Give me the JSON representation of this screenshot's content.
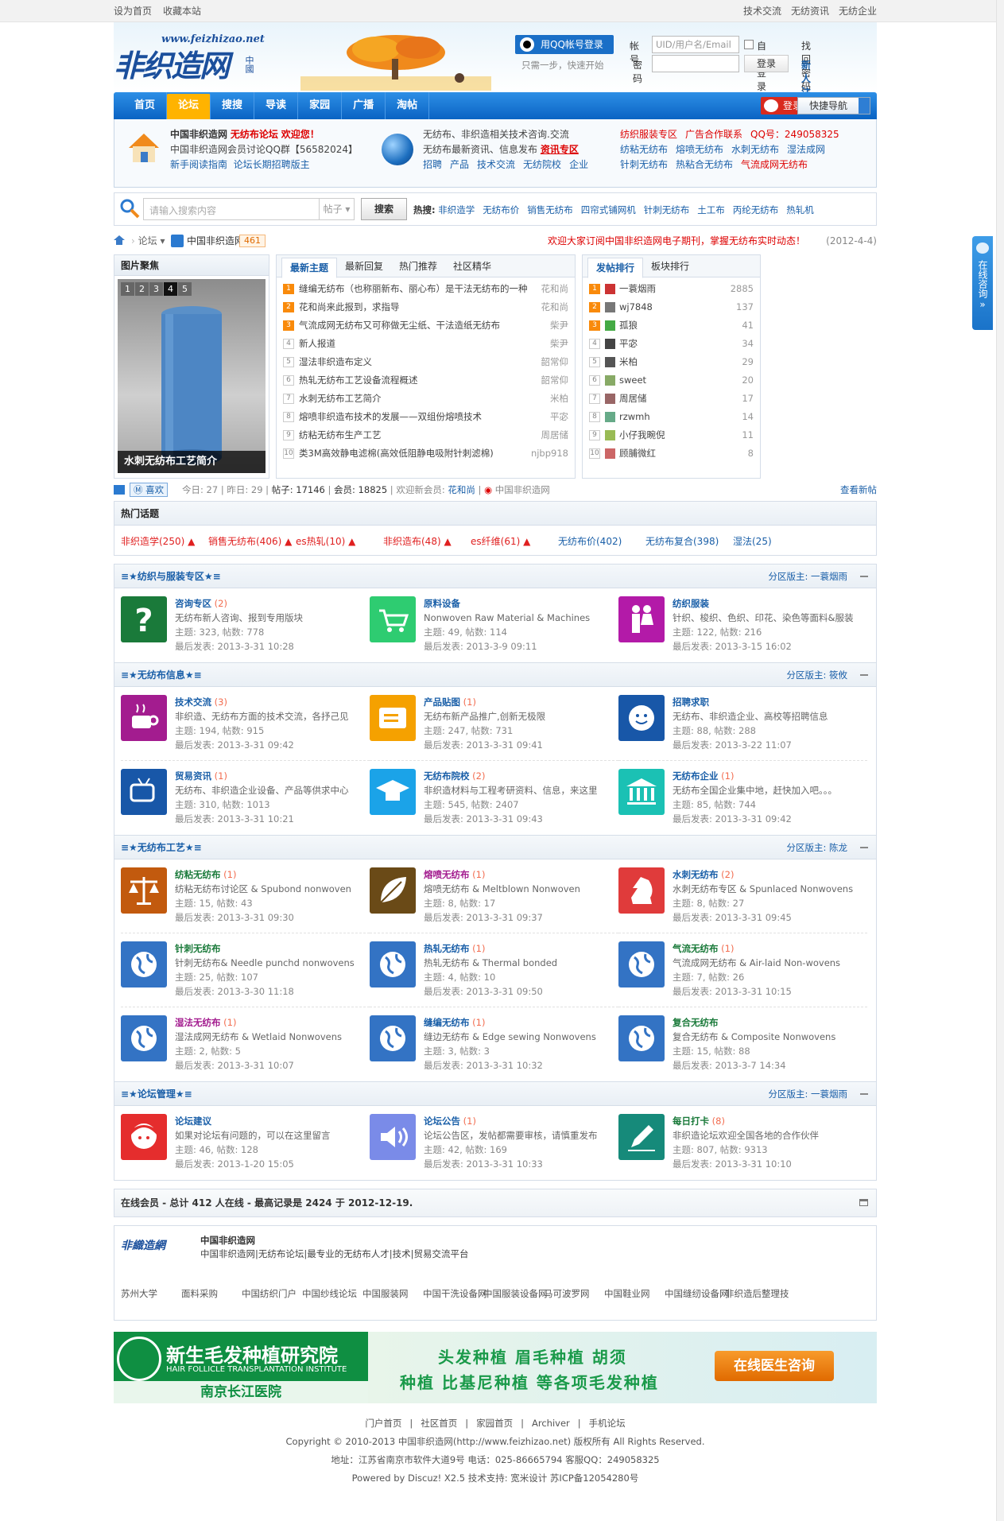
{
  "topbar": {
    "left": [
      "设为首页",
      "收藏本站"
    ],
    "right": [
      "技术交流",
      "无纺资讯",
      "无纺企业"
    ]
  },
  "header": {
    "logo_url_text": "www.feizhizao.net",
    "logo_brush": "非织造网",
    "logo_cn": "中國",
    "qq_login": "用QQ帐号登录",
    "qq_tip": "只需一步，快速开始",
    "account_label": "帐号",
    "account_placeholder": "UID/用户名/Email",
    "auto_login": "自动登录",
    "find_pw": "找回密码",
    "password_label": "密码",
    "login_btn": "登录",
    "register": "新人注册"
  },
  "nav": {
    "items": [
      "首页",
      "论坛",
      "搜搜",
      "导读",
      "家园",
      "广播",
      "淘帖"
    ],
    "active": 1,
    "weibo_login": "登录",
    "quick_nav": "快捷导航"
  },
  "info": {
    "c1": {
      "l1a": "中国非织造网",
      "l1b": "无纺布论坛",
      "l1c": "欢迎您！",
      "l2": "中国非织造网会员讨论QQ群【56582024】",
      "l3a": "新手阅读指南",
      "l3b": "论坛长期招聘版主"
    },
    "c2": {
      "l1": "无纺布、非织造相关技术咨询.交流",
      "l2a": "无纺布最新资讯、信息发布",
      "l2b": "资讯专区",
      "l3": [
        "招聘",
        "产品",
        "技术交流",
        "无纺院校",
        "企业"
      ]
    },
    "c3": {
      "l1": [
        "纺织服装专区",
        "广告合作联系",
        "QQ号：249058325"
      ],
      "l2": [
        "纺粘无纺布",
        "熔喷无纺布",
        "水刺无纺布",
        "湿法成网"
      ],
      "l3": [
        "针刺无纺布",
        "热粘合无纺布",
        "气流成网无纺布"
      ]
    }
  },
  "search": {
    "placeholder": "请输入搜索内容",
    "type": "帖子",
    "button": "搜索",
    "hot_label": "热搜:",
    "hot": [
      "非织造学",
      "无纺布价",
      "销售无纺布",
      "四帘式铺网机",
      "针刺无纺布",
      "土工布",
      "丙纶无纺布",
      "热轧机"
    ]
  },
  "crumb": {
    "forum": "论坛",
    "site": "中国非织造网",
    "count": "461",
    "notice": "欢迎大家订阅中国非织造网电子期刊，掌握无纺布实时动态！",
    "date": "(2012-4-4)"
  },
  "focus": {
    "title": "图片聚焦",
    "pages": [
      "1",
      "2",
      "3",
      "4",
      "5"
    ],
    "active": 3,
    "caption": "水刺无纺布工艺简介"
  },
  "threads": {
    "tabs": [
      "最新主题",
      "最新回复",
      "热门推荐",
      "社区精华"
    ],
    "items": [
      {
        "n": "1",
        "t": "缝编无纺布（也称丽新布、丽心布）是干法无纺布的一种",
        "a": "花和尚"
      },
      {
        "n": "2",
        "t": "花和尚来此报到，求指导",
        "a": "花和尚"
      },
      {
        "n": "3",
        "t": "气流成网无纺布又可称做无尘纸、干法造纸无纺布",
        "a": "柴尹"
      },
      {
        "n": "4",
        "t": "新人报道",
        "a": "柴尹"
      },
      {
        "n": "5",
        "t": "湿法非织造布定义",
        "a": "韶常仰"
      },
      {
        "n": "6",
        "t": "热轧无纺布工艺设备流程概述",
        "a": "韶常仰"
      },
      {
        "n": "7",
        "t": "水刺无纺布工艺简介",
        "a": "米柏"
      },
      {
        "n": "8",
        "t": "熔喷非织造布技术的发展——双组份熔喷技术",
        "a": "平宓"
      },
      {
        "n": "9",
        "t": "纺粘无纺布生产工艺",
        "a": "周居储"
      },
      {
        "n": "10",
        "t": "类3M高效静电滤棉(高效低阻静电吸附针刺滤棉)",
        "a": "njbp918"
      }
    ]
  },
  "ranks": {
    "tabs": [
      "发帖排行",
      "板块排行"
    ],
    "items": [
      {
        "n": "1",
        "u": "一蓑烟雨",
        "c": "2885",
        "col": "#c33"
      },
      {
        "n": "2",
        "u": "wj7848",
        "c": "137",
        "col": "#777"
      },
      {
        "n": "3",
        "u": "孤狼",
        "c": "41",
        "col": "#4a4"
      },
      {
        "n": "4",
        "u": "平宓",
        "c": "34",
        "col": "#444"
      },
      {
        "n": "5",
        "u": "米柏",
        "c": "29",
        "col": "#555"
      },
      {
        "n": "6",
        "u": "sweet",
        "c": "20",
        "col": "#8a6"
      },
      {
        "n": "7",
        "u": "周居储",
        "c": "17",
        "col": "#966"
      },
      {
        "n": "8",
        "u": "rzwmh",
        "c": "14",
        "col": "#6a8"
      },
      {
        "n": "9",
        "u": "小仔我畹倪",
        "c": "11",
        "col": "#9b5"
      },
      {
        "n": "10",
        "u": "顾脯微红",
        "c": "8",
        "col": "#c66"
      }
    ]
  },
  "stats": {
    "like": "喜欢",
    "today": "今日: 27",
    "yesterday": "昨日: 29",
    "posts": "帖子: 17146",
    "members": "会员: 18825",
    "welcome": "欢迎新会员:",
    "newmember": "花和尚",
    "weibo": "中国非织造网",
    "view_new": "查看新帖"
  },
  "hot_topics": {
    "title": "热门话题",
    "items": [
      {
        "t": "非织造学(250)",
        "hot": true
      },
      {
        "t": "销售无纺布(406)",
        "hot": true
      },
      {
        "t": "es热轧(10)",
        "hot": true
      },
      {
        "t": "非织造布(48)",
        "hot": true
      },
      {
        "t": "es纤维(61)",
        "hot": true
      },
      {
        "t": "无纺布价(402)",
        "hot": false
      },
      {
        "t": "无纺布复合(398)",
        "hot": false
      },
      {
        "t": "湿法(25)",
        "hot": false
      }
    ]
  },
  "sections": [
    {
      "title": "≡★纺织与服装专区★≡",
      "mod_label": "分区版主:",
      "mod": "一蓑烟雨",
      "forums": [
        {
          "name": "咨询专区",
          "count": "(2)",
          "desc": "无纺布新人咨询、报到专用版块",
          "stat": "主题: 323, 帖数: 778",
          "last": "最后发表: 2013-3-31 10:28",
          "icon": "question",
          "color": "#1a7a3a"
        },
        {
          "name": "原料设备",
          "count": "",
          "desc": "Nonwoven Raw Material & Machines",
          "stat": "主题: 49, 帖数: 114",
          "last": "最后发表: 2013-3-9 09:11",
          "icon": "cart",
          "color": "#2ecc71"
        },
        {
          "name": "纺织服装",
          "count": "",
          "desc": "针织、梭织、色织、印花、染色等面料&服装",
          "stat": "主题: 122, 帖数: 216",
          "last": "最后发表: 2013-3-15 16:02",
          "icon": "people",
          "color": "#b31aa8"
        }
      ]
    },
    {
      "title": "≡★无纺布信息★≡",
      "mod_label": "分区版主:",
      "mod": "筱攸",
      "forums": [
        {
          "name": "技术交流",
          "count": "(3)",
          "desc": "非织造、无纺布方面的技术交流，各抒己见",
          "stat": "主题: 194, 帖数: 915",
          "last": "最后发表: 2013-3-31 09:42",
          "icon": "cup",
          "color": "#a31c8f"
        },
        {
          "name": "产品贴图",
          "count": "(1)",
          "desc": "无纺布新产品推广,创新无极限",
          "stat": "主题: 247, 帖数: 731",
          "last": "最后发表: 2013-3-31 09:41",
          "icon": "folder",
          "color": "#f5a100"
        },
        {
          "name": "招聘求职",
          "count": "",
          "desc": "无纺布、非织造企业、高校等招聘信息",
          "stat": "主题: 88, 帖数: 288",
          "last": "最后发表: 2013-3-22 11:07",
          "icon": "smile",
          "color": "#1857a8"
        },
        {
          "name": "贸易资讯",
          "count": "(1)",
          "desc": "无纺布、非织造企业设备、产品等供求中心",
          "stat": "主题: 310, 帖数: 1013",
          "last": "最后发表: 2013-3-31 10:21",
          "icon": "tv",
          "color": "#1857a8"
        },
        {
          "name": "无纺布院校",
          "count": "(2)",
          "desc": "非织造材料与工程考研资料、信息，来这里",
          "stat": "主题: 545, 帖数: 2407",
          "last": "最后发表: 2013-3-31 09:43",
          "icon": "cap",
          "color": "#1ba3e8"
        },
        {
          "name": "无纺布企业",
          "count": "(1)",
          "desc": "无纺布全国企业集中地，赶快加入吧。。。",
          "stat": "主题: 85, 帖数: 744",
          "last": "最后发表: 2013-3-31 09:42",
          "icon": "bank",
          "color": "#1bc1b4"
        }
      ]
    },
    {
      "title": "≡★无纺布工艺★≡",
      "mod_label": "分区版主:",
      "mod": "陈龙",
      "forums": [
        {
          "name": "纺粘无纺布",
          "count": "(1)",
          "desc": "纺粘无纺布讨论区 & Spubond nonwoven",
          "stat": "主题: 15, 帖数: 43",
          "last": "最后发表: 2013-3-31 09:30",
          "icon": "scale",
          "color": "#c25a0e"
        },
        {
          "name": "熔喷无纺布",
          "count": "(1)",
          "desc": "熔喷无纺布 & Meltblown Nonwoven",
          "stat": "主题: 8, 帖数: 17",
          "last": "最后发表: 2013-3-31 09:37",
          "icon": "leaf",
          "color": "#6a4a17"
        },
        {
          "name": "水刺无纺布",
          "count": "(2)",
          "desc": "水刺无纺布专区 & Spunlaced Nonwovens",
          "stat": "主题: 8, 帖数: 27",
          "last": "最后发表: 2013-3-31 09:45",
          "icon": "knight",
          "color": "#e03b3b"
        },
        {
          "name": "针刺无纺布",
          "count": "",
          "desc": "针刺无纺布& Needle punchd nonwovens",
          "stat": "主题: 25, 帖数: 107",
          "last": "最后发表: 2013-3-30 11:18",
          "icon": "globe",
          "color": "#3373c4"
        },
        {
          "name": "热轧无纺布",
          "count": "(1)",
          "desc": "热轧无纺布 & Thermal bonded",
          "stat": "主题: 4, 帖数: 10",
          "last": "最后发表: 2013-3-31 09:50",
          "icon": "globe",
          "color": "#3373c4"
        },
        {
          "name": "气流无纺布",
          "count": "(1)",
          "desc": "气流成网无纺布 & Air-laid Non-wovens",
          "stat": "主题: 7, 帖数: 26",
          "last": "最后发表: 2013-3-31 10:15",
          "icon": "globe",
          "color": "#3373c4"
        },
        {
          "name": "湿法无纺布",
          "count": "(1)",
          "desc": "湿法成网无纺布 & Wetlaid Nonwovens",
          "stat": "主题: 2, 帖数: 5",
          "last": "最后发表: 2013-3-31 10:07",
          "icon": "globe",
          "color": "#3373c4"
        },
        {
          "name": "缝编无纺布",
          "count": "(1)",
          "desc": "缝边无纺布 & Edge sewing Nonwovens",
          "stat": "主题: 3, 帖数: 3",
          "last": "最后发表: 2013-3-31 10:32",
          "icon": "globe",
          "color": "#3373c4"
        },
        {
          "name": "复合无纺布",
          "count": "",
          "desc": "复合无纺布 & Composite Nonwovens",
          "stat": "主题: 15, 帖数: 88",
          "last": "最后发表: 2013-3-7 14:34",
          "icon": "globe",
          "color": "#3373c4"
        }
      ]
    },
    {
      "title": "≡★论坛管理★≡",
      "mod_label": "分区版主:",
      "mod": "一蓑烟雨",
      "forums": [
        {
          "name": "论坛建议",
          "count": "",
          "desc": "如果对论坛有问题的，可以在这里留言",
          "stat": "主题: 46, 帖数: 128",
          "last": "最后发表: 2013-1-20 15:05",
          "icon": "girl",
          "color": "#e52d2d"
        },
        {
          "name": "论坛公告",
          "count": "(1)",
          "desc": "论坛公告区，发帖都需要审核，请慎重发布",
          "stat": "主题: 42, 帖数: 169",
          "last": "最后发表: 2013-3-31 10:33",
          "icon": "speaker",
          "color": "#7a8be8"
        },
        {
          "name": "每日打卡",
          "count": "(8)",
          "desc": "非织造论坛欢迎全国各地的合作伙伴",
          "stat": "主题: 807, 帖数: 9313",
          "last": "最后发表: 2013-3-31 10:10",
          "icon": "pen",
          "color": "#168a7a"
        }
      ]
    }
  ],
  "online": "在线会员 - 总计 412 人在线 - 最高记录是 2424 于 2012-12-19.",
  "links": {
    "site": "中国非织造网",
    "desc": "中国非织造网|无纺布论坛|最专业的无纺布人才|技术|贸易交流平台",
    "items": [
      "苏州大学",
      "面料采购",
      "中国纺织门户",
      "中国纱线论坛",
      "中国服装网",
      "中国干洗设备网",
      "中国服装设备网",
      "马可波罗网",
      "中国鞋业网",
      "中国缝纫设备网",
      "非织造后整理技"
    ]
  },
  "banner": {
    "title": "新生毛发种植研究院",
    "sub": "HAIR FOLLICLE TRANSPLANTATION INSTITUTE",
    "hospital": "南京长江医院",
    "line1": "头发种植  眉毛种植  胡须",
    "line2": "种植  比基尼种植  等各项毛发种植",
    "cta": "在线医生咨询"
  },
  "footer": {
    "links": [
      "门户首页",
      "社区首页",
      "家园首页",
      "Archiver",
      "手机论坛"
    ],
    "copyright": "Copyright © 2010-2013 中国非织造网(http://www.feizhizao.net) 版权所有 All Rights Reserved.",
    "address": "地址：江苏省南京市软件大道9号 电话：025-86665794 客服QQ：249058325",
    "powered": "Powered by Discuz! X2.5  技术支持: 宽米设计 苏ICP备12054280号"
  },
  "side_tab": {
    "text": "在线咨询"
  }
}
